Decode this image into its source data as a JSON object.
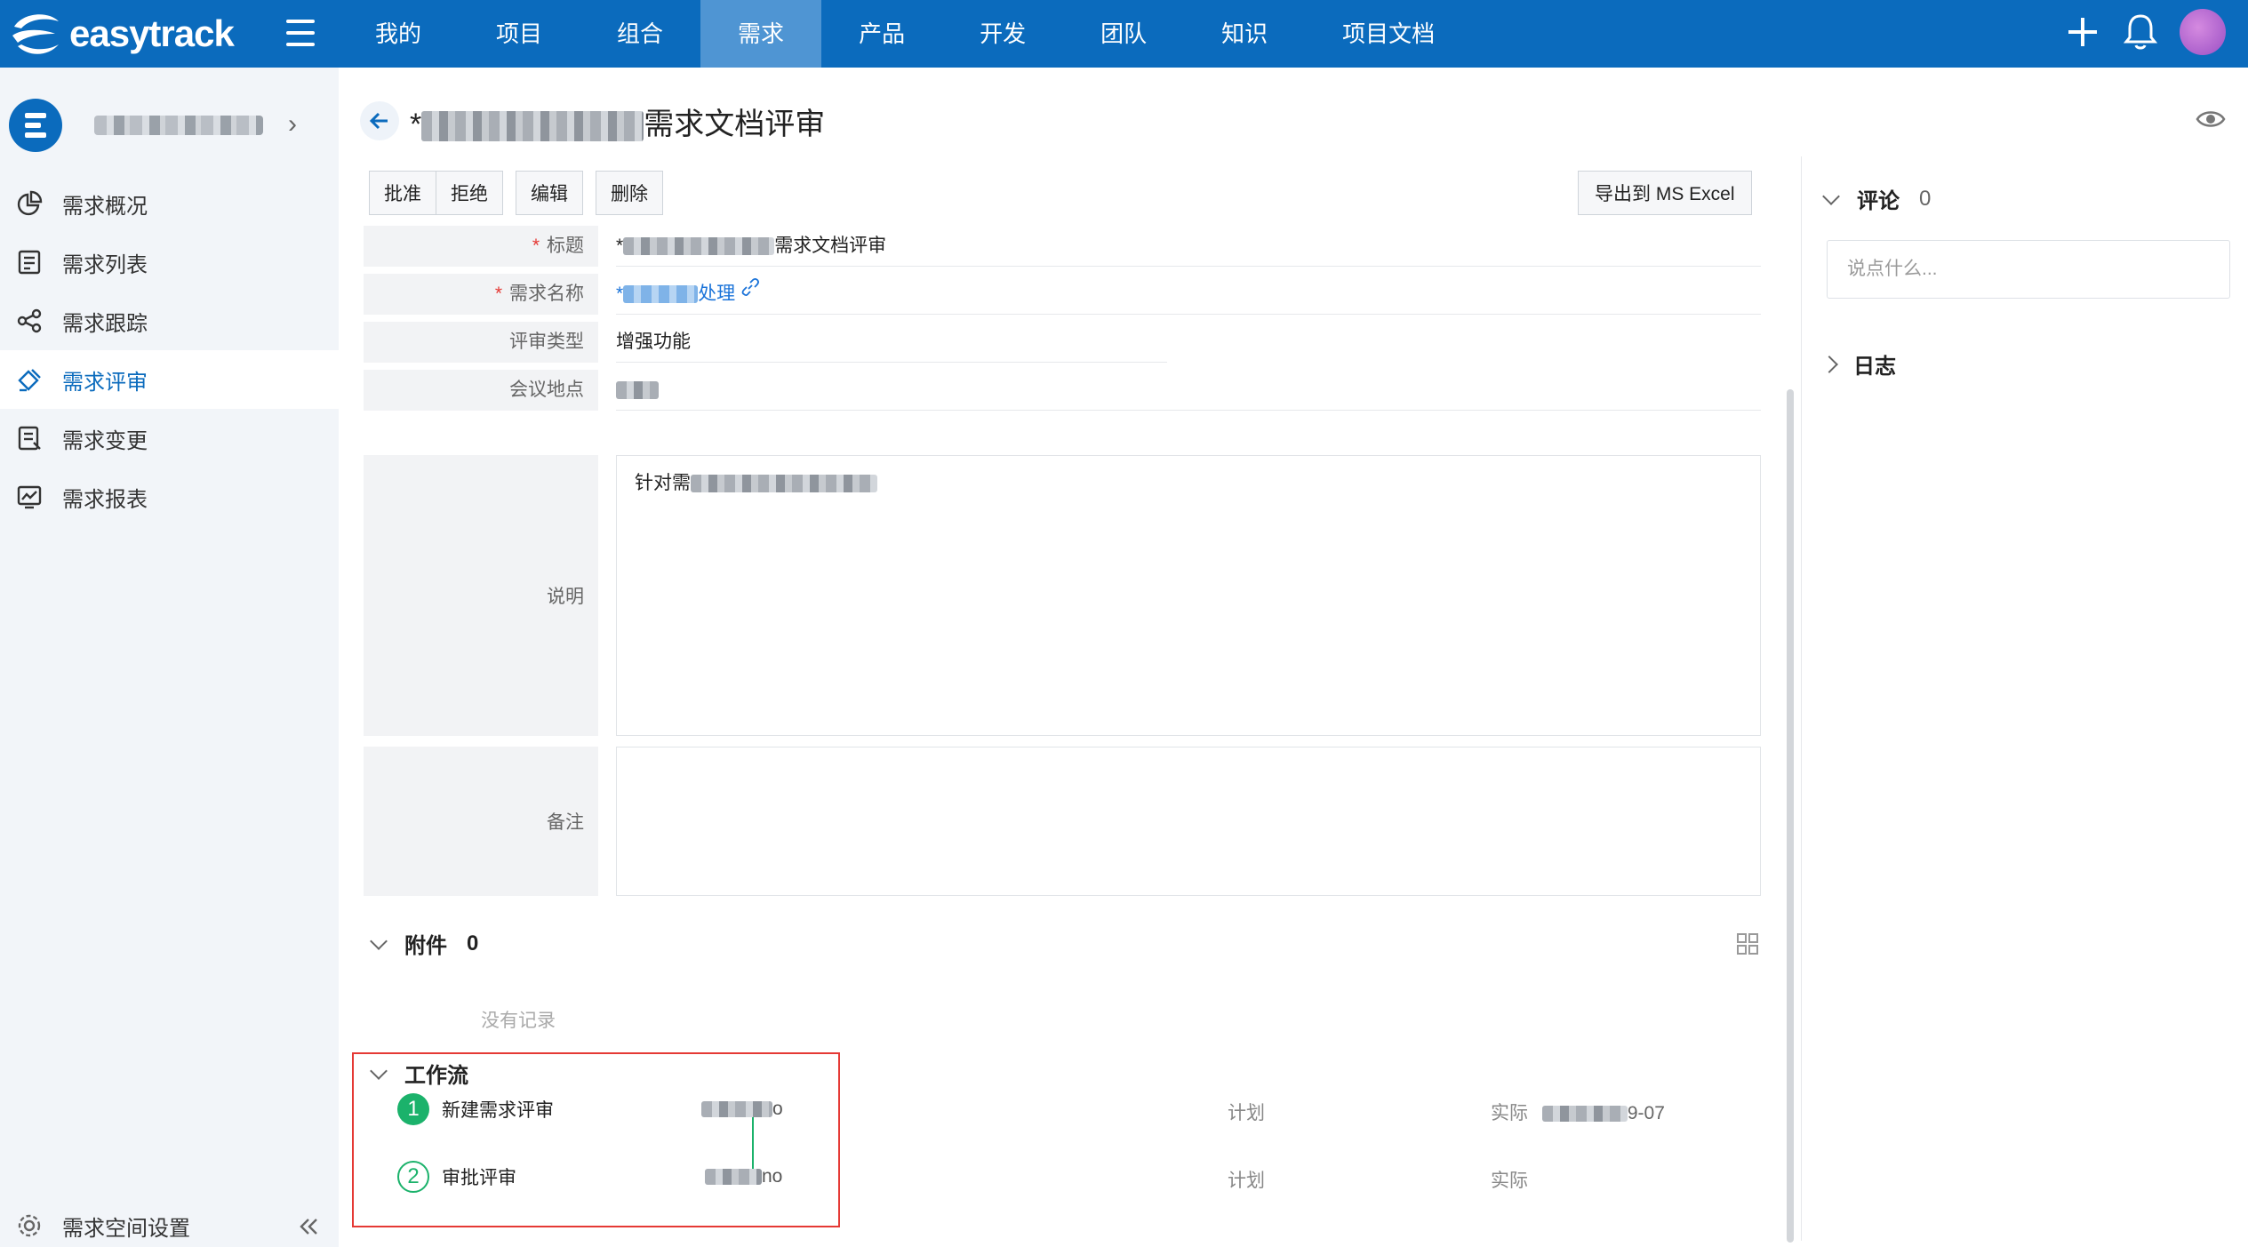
{
  "app": {
    "brand": "easytrack"
  },
  "nav": {
    "items": [
      {
        "label": "我的"
      },
      {
        "label": "项目"
      },
      {
        "label": "组合"
      },
      {
        "label": "需求",
        "active": true
      },
      {
        "label": "产品"
      },
      {
        "label": "开发"
      },
      {
        "label": "团队"
      },
      {
        "label": "知识"
      },
      {
        "label": "项目文档"
      }
    ]
  },
  "sidebar": {
    "items": [
      {
        "label": "需求概况",
        "icon": "pie-chart-icon"
      },
      {
        "label": "需求列表",
        "icon": "list-icon"
      },
      {
        "label": "需求跟踪",
        "icon": "share-icon"
      },
      {
        "label": "需求评审",
        "icon": "review-icon",
        "active": true
      },
      {
        "label": "需求变更",
        "icon": "change-icon"
      },
      {
        "label": "需求报表",
        "icon": "report-icon"
      }
    ],
    "footer_label": "需求空间设置"
  },
  "page": {
    "title_prefix": "*",
    "title_suffix": "需求文档评审"
  },
  "toolbar": {
    "approve": "批准",
    "reject": "拒绝",
    "edit": "编辑",
    "delete": "删除",
    "export": "导出到 MS Excel"
  },
  "form": {
    "title_label": "标题",
    "title_value_prefix": "*",
    "title_value_suffix": "需求文档评审",
    "req_name_label": "需求名称",
    "req_name_prefix": "*",
    "req_name_suffix": "处理",
    "review_type_label": "评审类型",
    "review_type_value": "增强功能",
    "location_label": "会议地点",
    "description_label": "说明",
    "description_value": "针对需",
    "remark_label": "备注"
  },
  "attachments": {
    "label": "附件",
    "count": "0",
    "empty_text": "没有记录"
  },
  "workflow": {
    "label": "工作流",
    "steps": [
      {
        "num": "1",
        "name": "新建需求评审",
        "user_suffix": "o",
        "plan_label": "计划",
        "actual_label": "实际",
        "actual_suffix": "9-07"
      },
      {
        "num": "2",
        "name": "审批评审",
        "user_suffix": "no",
        "plan_label": "计划",
        "actual_label": "实际"
      }
    ]
  },
  "right": {
    "comments_label": "评论",
    "comments_count": "0",
    "comment_placeholder": "说点什么...",
    "log_label": "日志"
  },
  "colors": {
    "primary": "#0b6bbd",
    "nav_active": "#4f95d3",
    "success": "#1bb26b",
    "highlight": "#e53935"
  }
}
